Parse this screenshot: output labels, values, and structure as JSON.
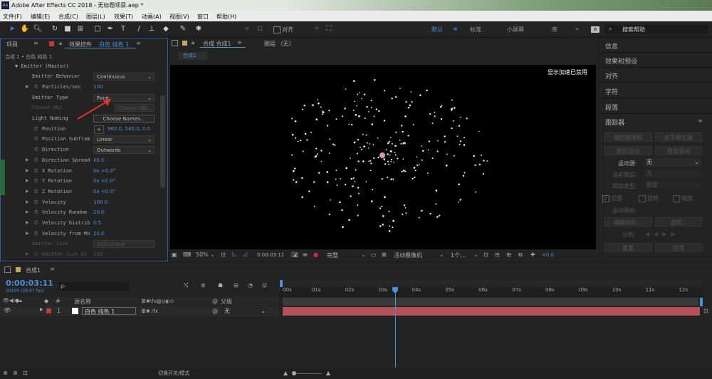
{
  "title": "Adobe After Effects CC 2018 - 无标题项目.aep *",
  "app_icon_label": "Ae",
  "menu": [
    "文件(F)",
    "编辑(E)",
    "合成(C)",
    "图层(L)",
    "效果(T)",
    "动画(A)",
    "视图(V)",
    "窗口",
    "帮助(H)"
  ],
  "toolbar": {
    "align_label": "对齐",
    "workspaces": [
      "默认",
      "标准",
      "小屏幕",
      "库"
    ],
    "active_workspace": "默认",
    "search_placeholder": "搜索帮助",
    "more": "»"
  },
  "project_tab": "项目",
  "effects_panel": {
    "tab_label": "效果控件",
    "tab_layer": "白色 纯色 1",
    "breadcrumb": "合成 1 • 白色 纯色 1",
    "section": "Emitter (Master)",
    "rows": [
      {
        "label": "Emitter Behavior",
        "value": "Continuous",
        "kind": "select"
      },
      {
        "label": "Particles/sec",
        "value": "100",
        "kind": "value"
      },
      {
        "label": "Emitter Type",
        "value": "Point",
        "kind": "select"
      },
      {
        "label": "Choose OBJ",
        "value": "Choose OBJ...",
        "kind": "disabled"
      },
      {
        "label": "Light Naming",
        "value": "Choose Names...",
        "kind": "button"
      },
      {
        "label": "Position",
        "value": "960.0, 540.0, 0.0",
        "kind": "value"
      },
      {
        "label": "Position Subfram",
        "value": "Linear",
        "kind": "select"
      },
      {
        "label": "Direction",
        "value": "Outwards",
        "kind": "select"
      },
      {
        "label": "Direction Spread",
        "value": "45.0",
        "kind": "value"
      },
      {
        "label": "X Rotation",
        "value": "0x +0.0°",
        "kind": "value"
      },
      {
        "label": "Y Rotation",
        "value": "0x +0.0°",
        "kind": "value"
      },
      {
        "label": "Z Rotation",
        "value": "0x +0.0°",
        "kind": "value"
      },
      {
        "label": "Velocity",
        "value": "100.0",
        "kind": "value"
      },
      {
        "label": "Velocity Random",
        "value": "20.0",
        "kind": "value"
      },
      {
        "label": "Velocity Distrib",
        "value": "0.5",
        "kind": "value"
      },
      {
        "label": "Velocity from Mo",
        "value": "20.0",
        "kind": "value"
      },
      {
        "label": "Emitter Size",
        "value": "XYZ Linked",
        "kind": "disabled"
      },
      {
        "label": "Emitter Size XY",
        "value": "100",
        "kind": "disabled"
      }
    ]
  },
  "comp_panel": {
    "tab_label": "合成 合成1",
    "layer_tab": "图层 （无）",
    "comp_chip": "合成1",
    "accel_notice": "显示加速已禁用",
    "zoom": "50%",
    "timecode": "0:00:03:11",
    "quality": "完整",
    "camera": "活动摄像机",
    "views": "1个...",
    "exposure": "+0.0"
  },
  "right_panel": {
    "items": [
      "信息",
      "效果和预设",
      "对齐",
      "字符",
      "段落"
    ],
    "tracker": {
      "title": "跟踪器",
      "btn_track_camera": "跟踪摄像机",
      "btn_warp_stabilizer": "变形稳定器",
      "btn_track_motion": "跟踪运动",
      "btn_stabilize_motion": "稳定运动",
      "motion_source_label": "运动源:",
      "motion_source_value": "无",
      "current_track_label": "当前跟踪:",
      "current_track_value": "无",
      "track_type_label": "跟踪类型:",
      "track_type_value": "稳定",
      "chk_position": "位置",
      "chk_rotation": "旋转",
      "chk_scale": "缩放",
      "motion_target_label": "运动目标:",
      "btn_edit_target": "编辑目标...",
      "btn_options": "选项...",
      "analyze_label": "分析:",
      "btn_reset": "重置",
      "btn_apply": "应用"
    }
  },
  "timeline": {
    "tab_label": "合成1",
    "timecode": "0:00:03:11",
    "frames_info": "00100 (29.97 fps)",
    "search_placeholder": "ρ-",
    "col_number": "#",
    "col_source": "源名称",
    "col_parent": "父级",
    "layer": {
      "index": "1",
      "name": "白色 纯色 1",
      "parent": "无"
    },
    "ticks": [
      "00s",
      "01s",
      "02s",
      "03s",
      "04s",
      "05s",
      "06s",
      "07s",
      "08s",
      "09s",
      "10s",
      "11s",
      "12s"
    ],
    "playhead_seconds": 3.37,
    "duration_seconds": 12.5,
    "switch_mode": "切换开关/模式"
  },
  "colors": {
    "accent": "#4a90d9",
    "layer_bar": "#b5505a",
    "label_red": "#c03a3a"
  }
}
